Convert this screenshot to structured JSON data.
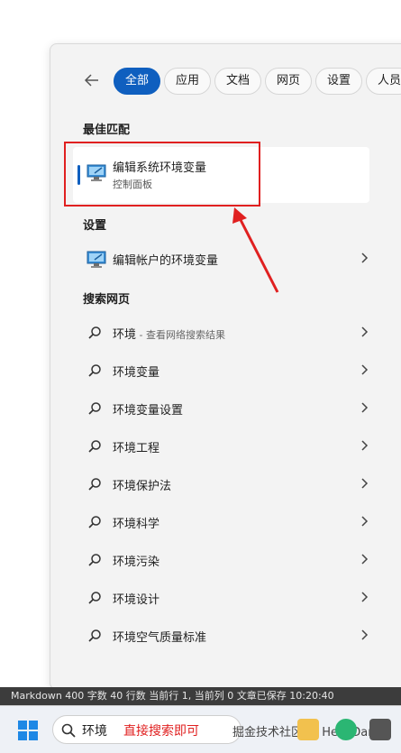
{
  "tabs": [
    {
      "label": "全部",
      "active": true
    },
    {
      "label": "应用",
      "active": false
    },
    {
      "label": "文档",
      "active": false
    },
    {
      "label": "网页",
      "active": false
    },
    {
      "label": "设置",
      "active": false
    },
    {
      "label": "人员",
      "active": false
    }
  ],
  "best_match": {
    "section_title": "最佳匹配",
    "title": "编辑系统环境变量",
    "subtitle": "控制面板"
  },
  "settings": {
    "section_title": "设置",
    "items": [
      {
        "label": "编辑帐户的环境变量"
      }
    ]
  },
  "web": {
    "section_title": "搜索网页",
    "items": [
      {
        "label": "环境",
        "hint": " - 查看网络搜索结果"
      },
      {
        "label": "环境变量"
      },
      {
        "label": "环境变量设置"
      },
      {
        "label": "环境工程"
      },
      {
        "label": "环境保护法"
      },
      {
        "label": "环境科学"
      },
      {
        "label": "环境污染"
      },
      {
        "label": "环境设计"
      },
      {
        "label": "环境空气质量标准"
      }
    ]
  },
  "statusbar": {
    "text": "Markdown  400 字数  40 行数  当前行 1, 当前列 0  文章已保存 10:20:40"
  },
  "taskbar": {
    "search_value": "环境",
    "annotation": "直接搜索即可",
    "watermark": "掘金技术社区 @ HelloDam"
  },
  "colors": {
    "accent": "#0f5fbf",
    "annotation": "#e02020"
  }
}
